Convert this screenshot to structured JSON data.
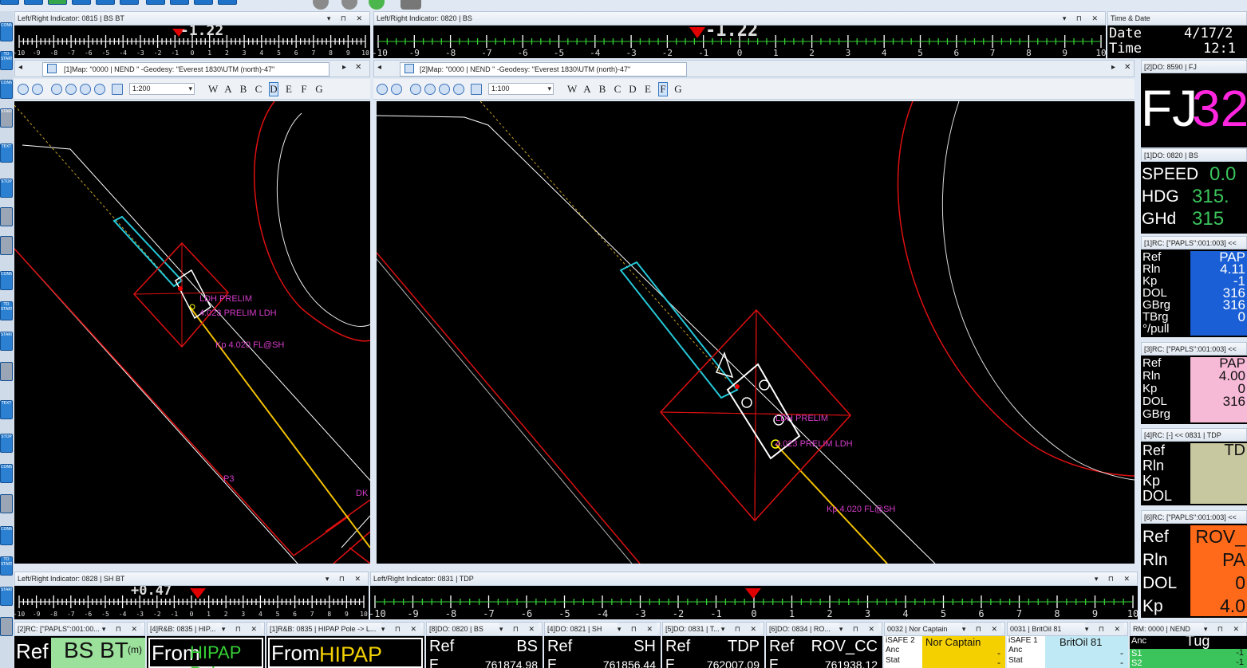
{
  "left_toolbar": {
    "buttons": [
      "CONNECT",
      "TO START",
      "CONNECT",
      "START",
      "TEXT",
      "STOP",
      "TO START",
      "CONNECT",
      "START",
      "TEXT",
      "STOP"
    ]
  },
  "indicators": {
    "top_left": {
      "title": "Left/Right Indicator: 0815 | BS BT",
      "value": "-1.22",
      "ticks": [
        "-10",
        "-9",
        "-8",
        "-7",
        "-6",
        "-5",
        "-4",
        "-3",
        "-2",
        "-1",
        "0",
        "1",
        "2",
        "3",
        "4",
        "5",
        "6",
        "7",
        "8",
        "9",
        "10"
      ]
    },
    "top_right": {
      "title": "Left/Right Indicator: 0820 | BS",
      "value": "-1.22"
    },
    "bottom_left": {
      "title": "Left/Right Indicator: 0828 | SH BT",
      "value": "+0.47"
    },
    "bottom_right": {
      "title": "Left/Right Indicator: 0831 | TDP"
    }
  },
  "time_date": {
    "title": "Time & Date",
    "date_label": "Date",
    "date_value": "4/17/2",
    "time_label": "Time",
    "time_value": "12:1"
  },
  "map1": {
    "tab_label": "[1]Map: \"0000 | NEND \"  -Geodesy: \"Everest 1830\\UTM (north)-47\"",
    "scale": "1:200",
    "letters": [
      "W",
      "A",
      "B",
      "C",
      "D",
      "E",
      "F",
      "G"
    ],
    "selected_letter": "D",
    "labels": {
      "prelim1": "LDH PRELIM",
      "prelim2": "4.023 PRELIM LDH",
      "flash": "Kp 4.020 FL@SH",
      "p3": "P3",
      "dk": "DK"
    }
  },
  "map2": {
    "tab_label": "[2]Map: \"0000 | NEND \"  -Geodesy: \"Everest 1830\\UTM (north)-47\"",
    "scale": "1:100",
    "letters": [
      "W",
      "A",
      "B",
      "C",
      "D",
      "E",
      "F",
      "G"
    ],
    "selected_letter": "F",
    "labels": {
      "prelim1": "LDH PRELIM",
      "prelim2": "4.023 PRELIM LDH",
      "flash": "Kp 4.020 FL@SH"
    }
  },
  "right_panels": {
    "do_fj": {
      "title": "[2]DO: 8590 | FJ",
      "text_a": "FJ",
      "text_b": "32"
    },
    "do_bs": {
      "title": "[1]DO: 0820 | BS",
      "rows": [
        {
          "label": "SPEED",
          "value": "0.0"
        },
        {
          "label": "HDG",
          "value": "315."
        },
        {
          "label": "GHd",
          "value": "315"
        }
      ]
    },
    "rc1": {
      "title": "[1]RC: [\"PAPLS\":001:003] <<",
      "labels": [
        "Ref",
        "Rln",
        "Kp",
        "DOL",
        "GBrg",
        "TBrg",
        "°/pull"
      ],
      "values": [
        "PAP",
        "4.11",
        "-1",
        "316",
        "316",
        "0"
      ]
    },
    "rc3": {
      "title": "[3]RC: [\"PAPLS\":001:003] <<",
      "labels": [
        "Ref",
        "Rln",
        "Kp",
        "DOL",
        "GBrg"
      ],
      "values": [
        "PAP",
        "4.00",
        "0",
        "316"
      ]
    },
    "rc4": {
      "title": "[4]RC: [-] << 0831 | TDP",
      "labels": [
        "Ref",
        "Rln",
        "Kp",
        "DOL"
      ],
      "values": [
        "TD"
      ]
    },
    "rc6": {
      "title": "[6]RC: [\"PAPLS\":001:003] <<",
      "labels": [
        "Ref",
        "Rln",
        "DOL",
        "Kp"
      ],
      "values": [
        "ROV_",
        "PA",
        "0",
        "4.0"
      ]
    }
  },
  "bottom_panels": {
    "rc2": {
      "title": "[2]RC: [\"PAPLS\":001:00...",
      "ref": "Ref",
      "name": "BS BT",
      "unit": "(m)"
    },
    "rb4": {
      "title": "[4]R&B: 0835 | HIP...",
      "from": "From",
      "name": "HIPAP Pole"
    },
    "rb1": {
      "title": "[1]R&B: 0835 | HIPAP Pole -> L...",
      "from": "From",
      "name": "HIPAP Pole"
    },
    "do8": {
      "title": "[8]DO: 0820 | BS",
      "ref": "Ref",
      "name": "BS",
      "e": "E",
      "val": "761874.98"
    },
    "do4": {
      "title": "[4]DO: 0821 | SH",
      "ref": "Ref",
      "name": "SH",
      "e": "E",
      "val": "761856.44"
    },
    "do5": {
      "title": "[5]DO: 0831 | T...",
      "ref": "Ref",
      "name": "TDP",
      "e": "E",
      "val": "762007.09"
    },
    "do6": {
      "title": "[6]DO: 0834 | RO...",
      "ref": "Ref",
      "name": "ROV_CC",
      "e": "E",
      "val": "761938.12"
    },
    "nor": {
      "title": "0032 | Nor Captain",
      "isafe": "iSAFE 2",
      "name": "Nor Captain",
      "anc": "Anc",
      "stat": "Stat",
      "dash": "-"
    },
    "brit": {
      "title": "0031 | BritOil 81",
      "isafe": "iSAFE 1",
      "name": "BritOil 81",
      "anc": "Anc",
      "stat": "Stat",
      "dash": "-"
    },
    "rm": {
      "title": "RM: 0000 | NEND",
      "anc": "Anc",
      "tug": "Tug",
      "s1": "S1",
      "s2": "S2",
      "v1": "-1",
      "v2": "-1"
    }
  }
}
